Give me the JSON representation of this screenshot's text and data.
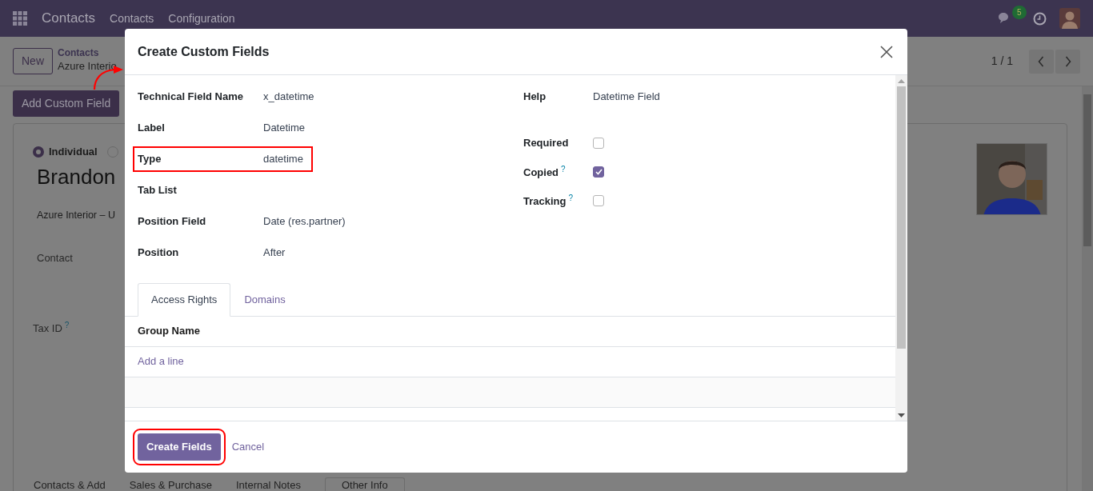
{
  "navbar": {
    "app": "Contacts",
    "menus": [
      "Contacts",
      "Configuration"
    ],
    "message_count": "5"
  },
  "control_panel": {
    "new_button": "New",
    "breadcrumb": "Contacts",
    "record": "Azure Interio",
    "pager": "1 / 1",
    "add_button": "Add Custom Field"
  },
  "form": {
    "company_types": [
      {
        "label": "Individual",
        "selected": true
      },
      {
        "selected": false
      }
    ],
    "name": "Brandon",
    "company": "Azure Interior – U",
    "fields": [
      {
        "label": "Contact"
      },
      {
        "label": "Tax ID",
        "help": "?"
      }
    ],
    "tabs": [
      {
        "label": "Contacts & Add",
        "selected": false
      },
      {
        "label": "Sales & Purchase",
        "selected": false
      },
      {
        "label": "Internal Notes",
        "selected": false
      },
      {
        "label": "Other Info",
        "selected": true
      }
    ]
  },
  "dialog": {
    "title": "Create Custom Fields",
    "left_fields": [
      {
        "label": "Technical Field Name",
        "value": "x_datetime",
        "highlighted": false
      },
      {
        "label": "Label",
        "value": "Datetime",
        "highlighted": false
      },
      {
        "label": "Type",
        "value": "datetime",
        "highlighted": true
      },
      {
        "label": "Tab List",
        "highlighted": false
      },
      {
        "label": "Position Field",
        "value": "Date (res.partner)",
        "highlighted": false
      },
      {
        "label": "Position",
        "value": "After",
        "highlighted": false
      }
    ],
    "help": {
      "label": "Help",
      "value": "Datetime Field"
    },
    "checkboxes": [
      {
        "label": "Required",
        "checked": false
      },
      {
        "label": "Copied",
        "help": "?",
        "checked": true
      },
      {
        "label": "Tracking",
        "help": "?",
        "checked": false
      }
    ],
    "tabs": [
      {
        "label": "Access Rights",
        "selected": true
      },
      {
        "label": "Domains",
        "selected": false
      }
    ],
    "table": {
      "columns": [
        "Group Name"
      ],
      "add_line": "Add a line"
    },
    "buttons": [
      {
        "label": "Create Fields",
        "kind": "primary",
        "highlighted": true
      },
      {
        "label": "Cancel",
        "kind": "link",
        "highlighted": false
      }
    ]
  }
}
